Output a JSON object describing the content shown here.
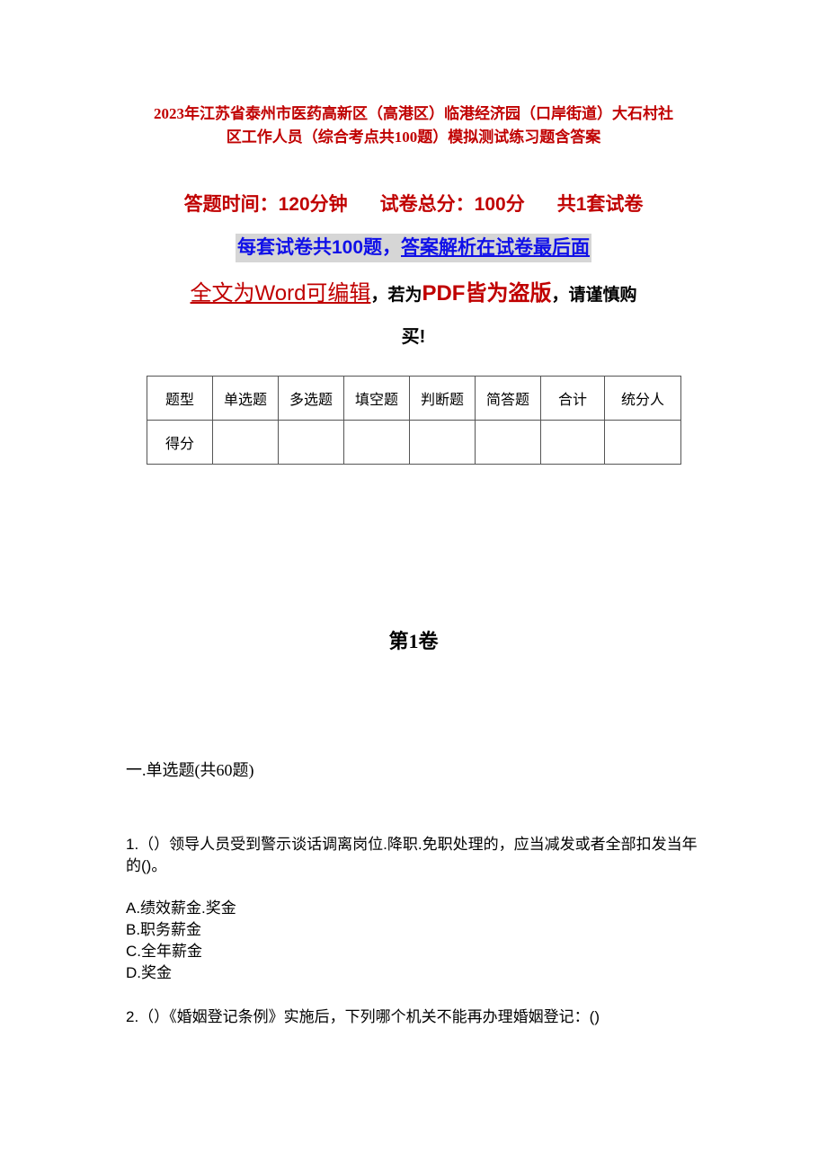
{
  "document": {
    "title_line1": "2023年江苏省泰州市医药高新区（高港区）临港经济园（口岸街道）大石村社",
    "title_line2": "区工作人员（综合考点共100题）模拟测试练习题含答案",
    "meta": {
      "time": "答题时间：120分钟",
      "total": "试卷总分：100分",
      "sets": "共1套试卷"
    },
    "notice": {
      "part1": "每套试卷共100题，",
      "part2": "答案解析在试卷最后面"
    },
    "warning": {
      "part1": "全文为Word可编辑",
      "comma1": "，若为",
      "part2": "PDF皆为盗版",
      "part3": "，请谨慎购",
      "part4": "买!"
    },
    "score_table": {
      "headers": [
        "题型",
        "单选题",
        "多选题",
        "填空题",
        "判断题",
        "简答题",
        "合计",
        "统分人"
      ],
      "row": [
        "得分",
        "",
        "",
        "",
        "",
        "",
        "",
        ""
      ]
    },
    "volume": "第1卷",
    "section": "一.单选题(共60题)",
    "questions": [
      {
        "text": "1.（）领导人员受到警示谈话调离岗位.降职.免职处理的，应当减发或者全部扣发当年的()。",
        "options": [
          "A.绩效薪金.奖金",
          "B.职务薪金",
          "C.全年薪金",
          "D.奖金"
        ]
      },
      {
        "text": "2.（）《婚姻登记条例》实施后，下列哪个机关不能再办理婚姻登记：()",
        "options": []
      }
    ]
  }
}
